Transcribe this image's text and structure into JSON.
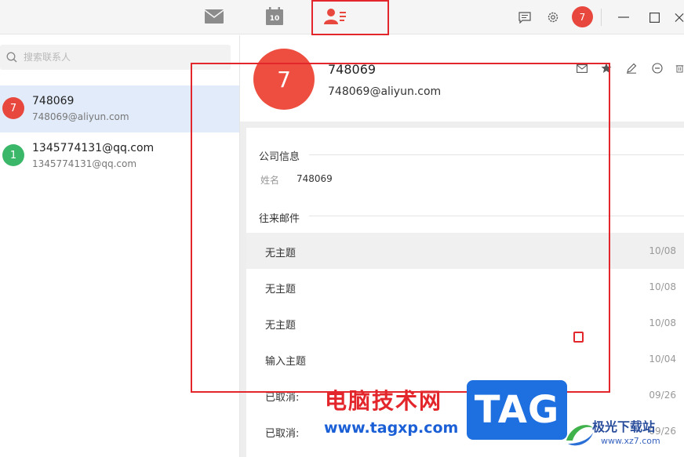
{
  "topbar": {
    "avatar_initial": "7",
    "tabs": [
      {
        "name": "mail",
        "icon": "envelope-icon"
      },
      {
        "name": "calendar",
        "icon": "calendar-icon",
        "day": "10"
      },
      {
        "name": "contacts",
        "icon": "contacts-icon"
      }
    ],
    "tools": [
      "chat-icon",
      "gear-icon"
    ],
    "window_controls": [
      "minimize-icon",
      "maximize-icon",
      "close-icon"
    ]
  },
  "sidebar": {
    "search_placeholder": "搜索联系人",
    "contacts": [
      {
        "initial": "7",
        "name": "748069",
        "email": "748069@aliyun.com",
        "color": "#e8473d",
        "selected": true
      },
      {
        "initial": "1",
        "name": "1345774131@qq.com",
        "email": "1345774131@qq.com",
        "color": "#3bb76a",
        "selected": false
      }
    ]
  },
  "detail": {
    "initial": "7",
    "name": "748069",
    "email": "748069@aliyun.com",
    "actions": [
      "mail-icon",
      "star-icon",
      "edit-icon",
      "remove-icon",
      "trash-icon"
    ],
    "company_section": "公司信息",
    "field_label": "姓名",
    "field_value": "748069",
    "mails_section": "往来邮件",
    "mails": [
      {
        "subject": "无主题",
        "date": "10/08",
        "highlighted": true
      },
      {
        "subject": "无主题",
        "date": "10/08",
        "highlighted": false
      },
      {
        "subject": "无主题",
        "date": "10/08",
        "highlighted": false
      },
      {
        "subject": "输入主题",
        "date": "10/04",
        "highlighted": false
      },
      {
        "subject": "已取消:",
        "date": "09/26",
        "highlighted": false
      },
      {
        "subject": "已取消:",
        "date": "09/26",
        "highlighted": false
      }
    ]
  },
  "watermark": {
    "cn": "电脑技术网",
    "url": "www.tagxp.com",
    "tag": "TAG",
    "logo_cn": "极光下载站",
    "logo_url": "www.xz7.com"
  },
  "colors": {
    "accent_red": "#e3262b",
    "selected_bg": "#e2ebf9",
    "avatar_red": "#ee4e3f",
    "avatar_green": "#3bb76a"
  }
}
